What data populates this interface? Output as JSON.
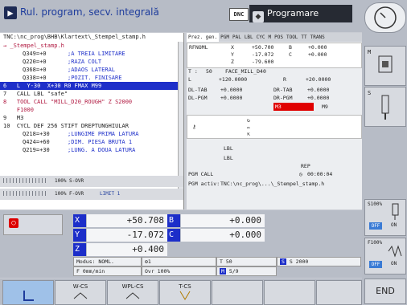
{
  "header": {
    "mode_title": "Rul. program, secv. integrală",
    "dnc_label": "DNC",
    "prog_mode_label": "Programare"
  },
  "program": {
    "path": "TNC:\\nc_prog\\BHB\\Klartext\\_Stempel_stamp.h",
    "current_file": "→ _Stempel_stamp.h",
    "lines": [
      {
        "num": "",
        "code": "Q349=+0",
        "comment": ";A TREIA LIMITARE"
      },
      {
        "num": "",
        "code": "Q220=+0",
        "comment": ";RAZA COLT"
      },
      {
        "num": "",
        "code": "Q368=+0",
        "comment": ";ADAOS LATERAL"
      },
      {
        "num": "",
        "code": "Q338=+0",
        "comment": ";POZIT. FINISARE"
      }
    ],
    "active_line": "6   L  Y-30  X+30 R0 FMAX M99",
    "line7": "7   CALL LBL \"safe\"",
    "line8a": "8   TOOL CALL \"MILL_D20_ROUGH\" Z S2000",
    "line8b": "    F1000",
    "line9": "9   M3",
    "line10": "10  CYCL DEF 256 STIFT DREPTUNGHIULAR",
    "line10_params": [
      {
        "code": "Q218=+30",
        "comment": ";LUNGIME PRIMA LATURA"
      },
      {
        "code": "Q424=+60",
        "comment": ";DIM. PIESA BRUTA 1"
      },
      {
        "code": "Q219=+30",
        "comment": ";LUNG. A DOUA LATURA"
      }
    ],
    "sovr": "100% S-OVR",
    "fovr": "100% F-OVR",
    "limit": "LIMIT 1"
  },
  "status": {
    "tabs": [
      "Prez. gen.",
      "PGM",
      "PAL",
      "LBL",
      "CYC",
      "M",
      "POS",
      "TOOL",
      "TT",
      "TRANS"
    ],
    "rfnoml": "RFNOML",
    "coords": [
      {
        "axis": "X",
        "value": "+50.700",
        "axis2": "B",
        "value2": "+0.000"
      },
      {
        "axis": "Y",
        "value": "-17.072",
        "axis2": "C",
        "value2": "+0.000"
      },
      {
        "axis": "Z",
        "value": "-79.600",
        "axis2": "",
        "value2": ""
      }
    ],
    "tool_label": "T :",
    "tool_num": "50",
    "tool_name": "FACE_MILL_D40",
    "L_label": "L",
    "L_value": "+120.0000",
    "R_label": "R",
    "R_value": "+20.0000",
    "dl_tab": "DL-TAB",
    "dl_tab_val": "+0.0000",
    "dr_tab": "DR-TAB",
    "dr_tab_val": "+0.0000",
    "dl_pgm": "DL-PGM",
    "dl_pgm_val": "+0.0000",
    "dr_pgm": "DR-PGM",
    "dr_pgm_val": "+0.0000",
    "m3": "M3",
    "m9": "M9",
    "lbl1": "LBL",
    "lbl2": "LBL",
    "rep": "REP",
    "pgm_call": "PGM CALL",
    "time": "00:00:04",
    "pgm_activ_label": "PGM activ:",
    "pgm_activ_path": "TNC:\\nc_prog\\...\\_Stempel_stamp.h"
  },
  "position": {
    "axes": [
      {
        "axis": "X",
        "value": "+50.708",
        "axis2": "B",
        "value2": "+0.000"
      },
      {
        "axis": "Y",
        "value": "-17.072",
        "axis2": "C",
        "value2": "+0.000"
      },
      {
        "axis": "Z",
        "value": "+0.400"
      }
    ],
    "modus": "Modus: NOML.",
    "tool_icon_num": "1",
    "t_field": "T 50",
    "s_label": "S",
    "s_field": "S 2000",
    "f_field": "F 0mm/min",
    "ovr_field": "Ovr 100%",
    "m_label": "M",
    "m_field": "5/9"
  },
  "right_softkeys": {
    "m_label": "M",
    "s_label": "S",
    "s100": "S100%",
    "f100": "F100%",
    "off1": "OFF",
    "on1": "ON",
    "off2": "OFF",
    "on2": "ON",
    "end": "END"
  },
  "bottom_softkeys": {
    "wcs": "W-CS",
    "wplcs": "WPL-CS",
    "tcs": "T-CS"
  }
}
